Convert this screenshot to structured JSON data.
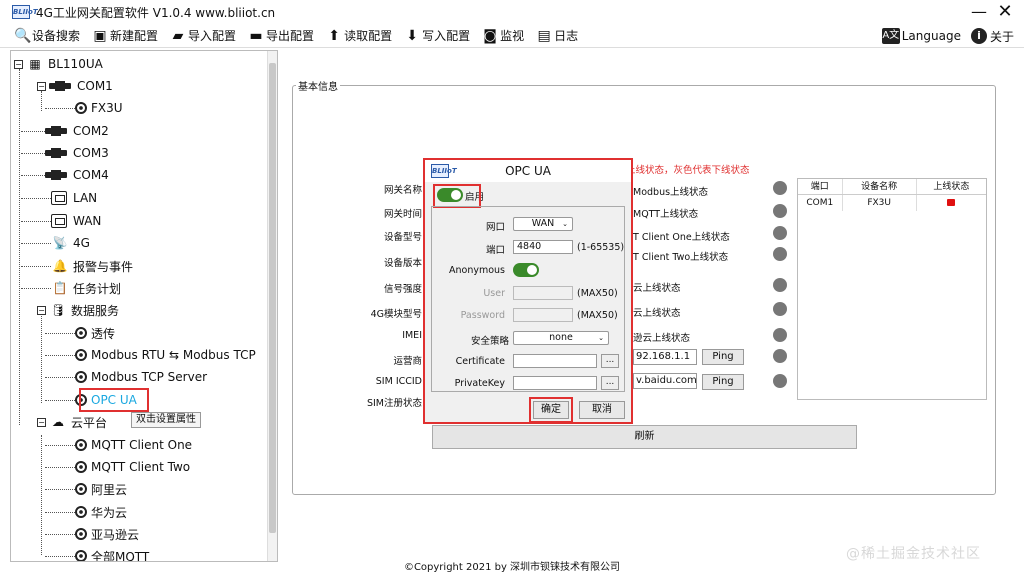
{
  "window": {
    "title": "4G工业网关配置软件 V1.0.4 www.bliiot.cn",
    "logo_text": "BLIIoT",
    "minimize": "—",
    "close": "✕"
  },
  "toolbar": {
    "items": [
      {
        "label": "设备搜索",
        "icon": "search-icon"
      },
      {
        "label": "新建配置",
        "icon": "new-config-icon"
      },
      {
        "label": "导入配置",
        "icon": "folder-import-icon"
      },
      {
        "label": "导出配置",
        "icon": "save-export-icon"
      },
      {
        "label": "读取配置",
        "icon": "upload-read-icon"
      },
      {
        "label": "写入配置",
        "icon": "download-write-icon"
      },
      {
        "label": "监视",
        "icon": "monitor-icon"
      },
      {
        "label": "日志",
        "icon": "log-icon"
      }
    ],
    "language": "Language",
    "language_icon_text": "A文",
    "about": "关于",
    "about_icon_text": "i"
  },
  "tree": {
    "root": "BL110UA",
    "com1": "COM1",
    "fx3u": "FX3U",
    "com2": "COM2",
    "com3": "COM3",
    "com4": "COM4",
    "lan": "LAN",
    "wan": "WAN",
    "g4": "4G",
    "alarm": "报警与事件",
    "task": "任务计划",
    "data_service": "数据服务",
    "passthrough": "透传",
    "modbus_rtu_tcp": "Modbus RTU ⇆ Modbus TCP",
    "modbus_tcp_server": "Modbus TCP Server",
    "opc_ua": "OPC UA",
    "tooltip": "双击设置属性",
    "cloud": "云平台",
    "mqtt_one": "MQTT Client One",
    "mqtt_two": "MQTT Client Two",
    "aliyun": "阿里云",
    "huawei": "华为云",
    "amazon": "亚马逊云",
    "all_mqtt": "全部MQTT"
  },
  "main": {
    "group_title": "基本信息",
    "left_labels": [
      "网关名称",
      "网关时间",
      "设备型号",
      "设备版本",
      "信号强度",
      "4G模块型号",
      "IMEI",
      "运营商",
      "SIM ICCID",
      "SIM注册状态"
    ],
    "legend_note": "上线状态，灰色代表下线状态",
    "status_labels": [
      "Modbus上线状态",
      "MQTT上线状态",
      "T Client One上线状态",
      "T Client Two上线状态",
      "云上线状态",
      "云上线状态",
      "逊云上线状态"
    ],
    "ping1_value": "92.168.1.1",
    "ping2_value": "v.baidu.com",
    "ping_label": "Ping",
    "refresh": "刷新",
    "table": {
      "headers": [
        "端口",
        "设备名称",
        "上线状态"
      ],
      "rows": [
        {
          "port": "COM1",
          "device": "FX3U",
          "status": "offline-red"
        }
      ]
    }
  },
  "dialog": {
    "title": "OPC UA",
    "enable_label": "启用",
    "enable_on": true,
    "port_iface_label": "网口",
    "port_iface_value": "WAN",
    "port_label": "端口",
    "port_value": "4840",
    "port_range": "(1-65535)",
    "anonymous_label": "Anonymous",
    "anonymous_on": true,
    "user_label": "User",
    "user_value": "",
    "user_max": "(MAX50)",
    "password_label": "Password",
    "password_value": "",
    "password_max": "(MAX50)",
    "security_label": "安全策略",
    "security_value": "none",
    "certificate_label": "Certificate",
    "privatekey_label": "PrivateKey",
    "browse": "...",
    "ok": "确定",
    "cancel": "取消"
  },
  "footer": {
    "copyright": "©Copyright 2021 by 深圳市钡铼技术有限公司"
  },
  "watermark": "@稀土掘金技术社区",
  "colors": {
    "accent_red": "#e03030",
    "toggle_green": "#3a8a2a",
    "opc_blue": "#1aa8e0"
  }
}
